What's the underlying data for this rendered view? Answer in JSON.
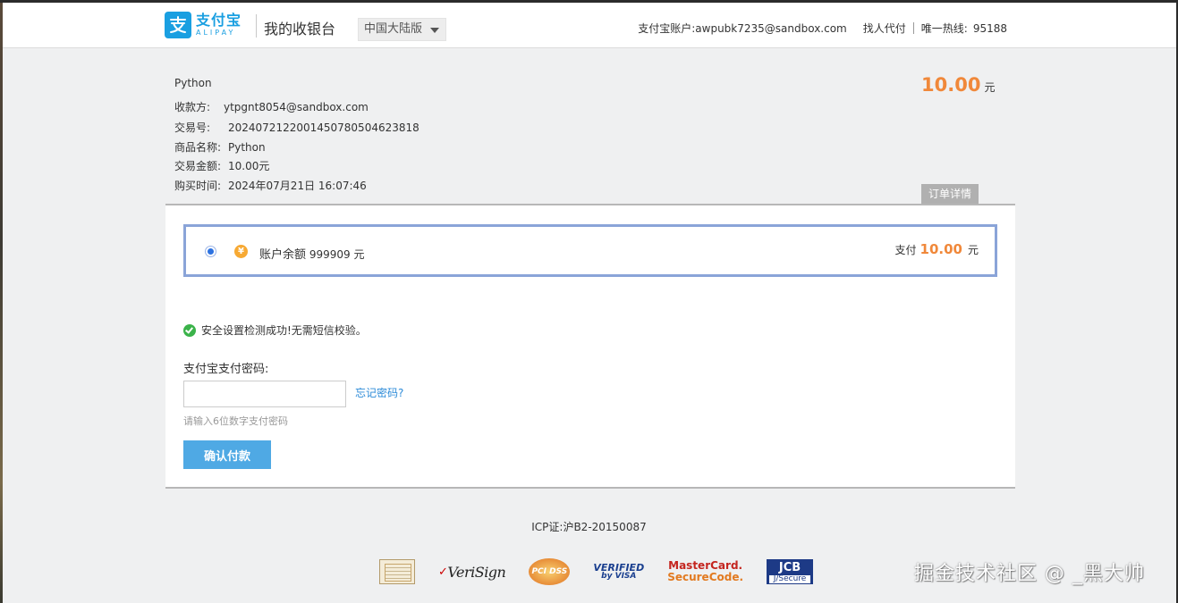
{
  "header": {
    "logo_cn": "支付宝",
    "logo_en": "ALIPAY",
    "cashier_title": "我的收银台",
    "region": "中国大陆版",
    "account_label": "支付宝账户:",
    "account": "awpubk7235@sandbox.com",
    "find_payer": "找人代付",
    "hotline_label": "唯一热线:",
    "hotline": "95188"
  },
  "order": {
    "name": "Python",
    "payee_label": "收款方:",
    "payee": "ytpgnt8054@sandbox.com",
    "trade_no_label": "交易号:",
    "trade_no": "2024072122001450780504623818",
    "product_label": "商品名称:",
    "product": "Python",
    "trade_amount_label": "交易金额:",
    "trade_amount": "10.00元",
    "time_label": "购买时间:",
    "time": "2024年07月21日 16:07:46",
    "amount": "10.00",
    "amount_unit": "元",
    "detail_tab": "订单详情"
  },
  "payment": {
    "coin_symbol": "¥",
    "method_label": "账户余额",
    "balance": "999909",
    "balance_unit": "元",
    "pay_label": "支付",
    "pay_amount": "10.00",
    "pay_unit": "元",
    "selected": true
  },
  "security": {
    "message": "安全设置检测成功!无需短信校验。",
    "status_color": "#3bb34a"
  },
  "password": {
    "label": "支付宝支付密码:",
    "value": "",
    "forgot": "忘记密码?",
    "hint": "请输入6位数字支付密码"
  },
  "confirm_button": "确认付款",
  "footer": {
    "icp": "ICP证:沪B2-20150087",
    "badges": {
      "verisign": "VeriSign",
      "pci": "PCI DSS",
      "visa_1": "VERIFIED",
      "visa_2": "by VISA",
      "mc_1": "MasterCard.",
      "mc_2": "SecureCode.",
      "jcb_1": "JCB",
      "jcb_2": "J/Secure"
    }
  },
  "watermark": "掘金技术社区 @ _黑大帅",
  "colors": {
    "brand": "#1a9fe1",
    "amount": "#f0883a",
    "button": "#4fa9e4",
    "link": "#2d8bd8",
    "selected_border": "#8aa4d8"
  }
}
